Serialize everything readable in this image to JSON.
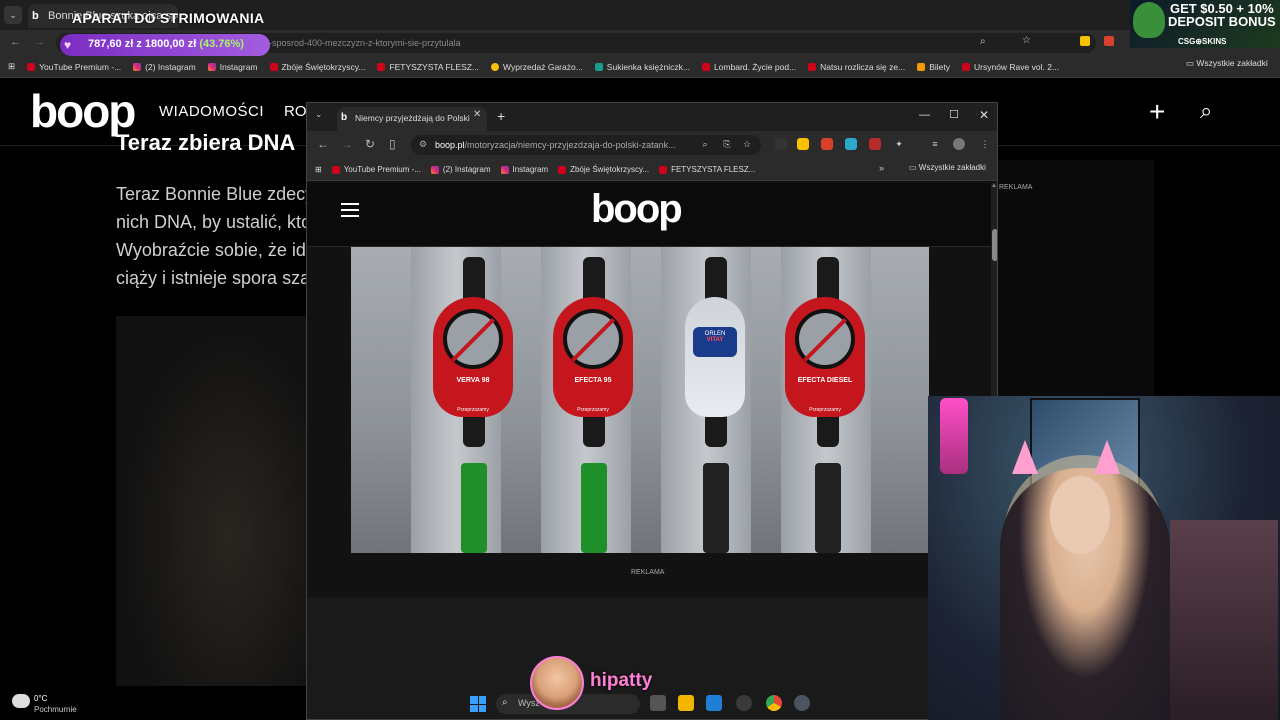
{
  "background_browser": {
    "tab_title": "Bonnie Blue szuka ojca spośród...",
    "url_suffix": "blue-szuka-ojca-sposrod-400-mezczyzn-z-ktorymi-sie-przytulala",
    "bookmarks": [
      "YouTube Premium -...",
      "(2) Instagram",
      "Instagram",
      "Zbóje Świętokrzyscy...",
      "FETYSZYSTA FLESZ...",
      "Wyprzedaż Garażo...",
      "Sukienka księżniczk...",
      "Lombard. Życie pod...",
      "Natsu rozlicza się ze...",
      "Bilety",
      "Ursynów Rave vol. 2..."
    ],
    "all_bookmarks": "Wszystkie zakładki"
  },
  "background_site": {
    "logo": "boop",
    "nav": [
      "WIADOMOŚCI",
      "ROZ"
    ],
    "heading_fragment": "Teraz zbiera DNA",
    "lines": [
      "Teraz Bonnie Blue zdecy",
      "nich DNA, by ustalić, kto",
      "Wyobraźcie sobie, że id",
      "ciąży i istnieje spora sza"
    ],
    "ad_label": "REKLAMA"
  },
  "stream_overlay": {
    "title": "APARAT DO STRIMOWANIA",
    "goal_amount": "787,60 zł z 1800,00 zł",
    "goal_percent": "(43.76%)",
    "goal_fraction": 0.4376,
    "promo_line1": "GET $0.50 + 10%",
    "promo_line2": "DEPOSIT BONUS",
    "promo_brand": "CSG⊕SKINS",
    "streamer_name": "hipatty"
  },
  "foreground_browser": {
    "tab_title": "Niemcy przyjeżdżają do Polski",
    "url_domain": "boop.pl",
    "url_path": "/motoryzacja/niemcy-przyjezdzaja-do-polski-zatank...",
    "bookmarks": [
      "YouTube Premium -...",
      "(2) Instagram",
      "Instagram",
      "Zbóje Świętokrzyscy...",
      "FETYSZYSTA FLESZ..."
    ],
    "all_bookmarks": "Wszystkie zakładki",
    "site_logo": "boop",
    "ad_label": "REKLAMA",
    "nozzles": [
      {
        "label": "VERVA 98",
        "sub": "Przeprzszamy"
      },
      {
        "label": "EFECTA 95",
        "sub": "Przeprzszamy"
      },
      {
        "label": "VITAY",
        "sub": "ORLEN"
      },
      {
        "label": "EFECTA DIESEL",
        "sub": "Przeprzszamy"
      }
    ]
  },
  "taskbar": {
    "temperature": "0°C",
    "weather": "Pochmurnie",
    "search_placeholder": "Wysz"
  }
}
